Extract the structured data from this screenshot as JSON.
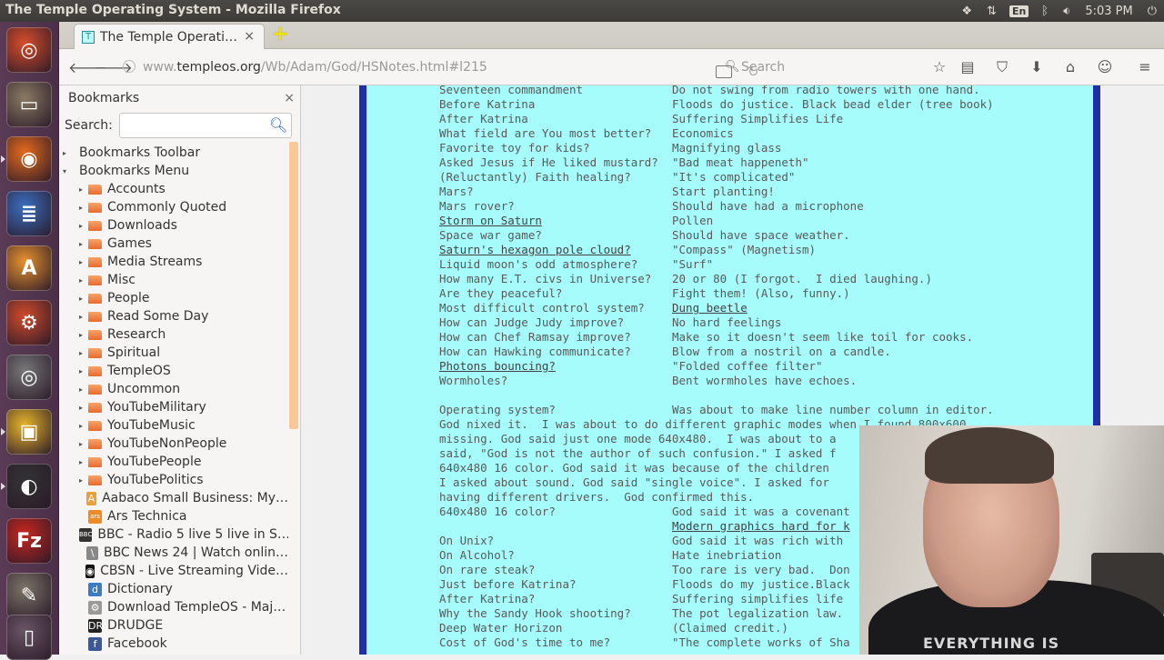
{
  "window": {
    "title": "The Temple Operating System - Mozilla Firefox"
  },
  "panel": {
    "keyboard": "En",
    "clock": "5:03 PM"
  },
  "launcher": {
    "items": [
      {
        "name": "ubuntu-dash-icon",
        "color": "#d84d2a",
        "glyph": "◎"
      },
      {
        "name": "files-icon",
        "color": "#8a7a62",
        "glyph": "▭"
      },
      {
        "name": "firefox-icon",
        "color": "#e66a1c",
        "glyph": "◉"
      },
      {
        "name": "writer-icon",
        "color": "#3a6ec0",
        "glyph": "≣"
      },
      {
        "name": "software-center-icon",
        "color": "#e8922e",
        "glyph": "A"
      },
      {
        "name": "system-settings-icon",
        "color": "#cf4a2b",
        "glyph": "⚙"
      },
      {
        "name": "dvd-icon",
        "color": "#777777",
        "glyph": "◎"
      },
      {
        "name": "workspace-switcher-icon",
        "color": "#e7b52a",
        "glyph": "▣"
      },
      {
        "name": "obs-icon",
        "color": "#333333",
        "glyph": "◐"
      },
      {
        "name": "filezilla-icon",
        "color": "#c8261e",
        "glyph": "Fz"
      },
      {
        "name": "gimp-icon",
        "color": "#7b7367",
        "glyph": "✎"
      },
      {
        "name": "trash-icon",
        "color": "#6a5565",
        "glyph": "▯"
      }
    ]
  },
  "tab": {
    "title": "The Temple Operati…",
    "favicon": "T"
  },
  "navbar": {
    "url_prefix": "www.",
    "url_domain": "templeos.org",
    "url_path": "/Wb/Adam/God/HSNotes.html#l215",
    "search_placeholder": "Search"
  },
  "sidebar": {
    "title": "Bookmarks",
    "search_label": "Search:",
    "items": [
      {
        "label": "Bookmarks Toolbar",
        "kind": "root-closed"
      },
      {
        "label": "Bookmarks Menu",
        "kind": "root-open"
      },
      {
        "label": "Accounts",
        "kind": "folder"
      },
      {
        "label": "Commonly Quoted",
        "kind": "folder"
      },
      {
        "label": "Downloads",
        "kind": "folder"
      },
      {
        "label": "Games",
        "kind": "folder"
      },
      {
        "label": "Media Streams",
        "kind": "folder"
      },
      {
        "label": "Misc",
        "kind": "folder"
      },
      {
        "label": "People",
        "kind": "folder"
      },
      {
        "label": "Read Some Day",
        "kind": "folder"
      },
      {
        "label": "Research",
        "kind": "folder"
      },
      {
        "label": "Spiritual",
        "kind": "folder"
      },
      {
        "label": "TempleOS",
        "kind": "folder"
      },
      {
        "label": "Uncommon",
        "kind": "folder"
      },
      {
        "label": "YouTubeMilitary",
        "kind": "folder"
      },
      {
        "label": "YouTubeMusic",
        "kind": "folder"
      },
      {
        "label": "YouTubeNonPeople",
        "kind": "folder"
      },
      {
        "label": "YouTubePeople",
        "kind": "folder"
      },
      {
        "label": "YouTubePolitics",
        "kind": "folder"
      },
      {
        "label": "Aabaco Small Business: My…",
        "kind": "link",
        "icon": "A",
        "color": "#e8a13a"
      },
      {
        "label": "Ars Technica",
        "kind": "link",
        "icon": "ars",
        "color": "#f08a24"
      },
      {
        "label": "BBC - Radio 5 live 5 live in S…",
        "kind": "link",
        "icon": "BBC",
        "color": "#333333"
      },
      {
        "label": "BBC News 24 | Watch onlin…",
        "kind": "link",
        "icon": "\\",
        "color": "#888888"
      },
      {
        "label": "CBSN - Live Streaming Vide…",
        "kind": "link",
        "icon": "◉",
        "color": "#111111"
      },
      {
        "label": "Dictionary",
        "kind": "link",
        "icon": "d",
        "color": "#3a7bc8"
      },
      {
        "label": "Download TempleOS - Maj…",
        "kind": "link",
        "icon": "⚙",
        "color": "#999999"
      },
      {
        "label": "DRUDGE",
        "kind": "link",
        "icon": "DR",
        "color": "#222222"
      },
      {
        "label": "Facebook",
        "kind": "link",
        "icon": "f",
        "color": "#3b5998"
      }
    ]
  },
  "doc": {
    "rows": [
      {
        "q": "Seventeen commandment",
        "a": "Do not swing from radio towers with one hand."
      },
      {
        "q": "Before Katrina",
        "a": "Floods do justice. Black bead elder (tree book)"
      },
      {
        "q": "After Katrina",
        "a": "Suffering Simplifies Life"
      },
      {
        "q": "What field are You most better?",
        "a": "Economics"
      },
      {
        "q": "Favorite toy for kids?",
        "a": "Magnifying glass"
      },
      {
        "q": "Asked Jesus if He liked mustard?",
        "a": "\"Bad meat happeneth\""
      },
      {
        "q": "(Reluctantly) Faith healing?",
        "a": "\"It's complicated\""
      },
      {
        "q": "Mars?",
        "a": "Start planting!"
      },
      {
        "q": "Mars rover?",
        "a": "Should have had a microphone"
      },
      {
        "q": "Storm on Saturn",
        "a": "Pollen",
        "qlink": true
      },
      {
        "q": "Space war game?",
        "a": "Should have space weather."
      },
      {
        "q": "Saturn's hexagon pole cloud?",
        "a": "\"Compass\" (Magnetism)",
        "qlink": true
      },
      {
        "q": "Liquid moon's odd atmosphere?",
        "a": "\"Surf\""
      },
      {
        "q": "How many E.T. civs in Universe?",
        "a": "20 or 80 (I forgot.  I died laughing.)"
      },
      {
        "q": "Are they peaceful?",
        "a": "Fight them! (Also, funny.)"
      },
      {
        "q": "Most difficult control system?",
        "a": "Dung beetle",
        "alink": true
      },
      {
        "q": "How can Judge Judy improve?",
        "a": "No hard feelings"
      },
      {
        "q": "How can Chef Ramsay improve?",
        "a": "Make so it doesn't seem like toil for cooks."
      },
      {
        "q": "How can Hawking communicate?",
        "a": "Blow from a nostril on a candle."
      },
      {
        "q": "Photons bouncing?",
        "a": "\"Folded coffee filter\"",
        "qlink": true
      },
      {
        "q": "Wormholes?",
        "a": "Bent wormholes have echoes."
      }
    ],
    "os_q": "Operating system?",
    "os_a": "Was about to make line number column in editor.",
    "paragraph": [
      "God nixed it.  I was about to do different graphic modes when I found 800x600",
      "missing. God said just one mode 640x480.  I was about to a",
      "said, \"God is not the author of such confusion.\" I asked f",
      "640x480 16 color. God said it was because of the children",
      "I asked about sound. God said \"single voice\". I asked for",
      "having different drivers.  God confirmed this."
    ],
    "rows2": [
      {
        "q": "640x480 16 color?",
        "a": "God said it was a covenant"
      },
      {
        "q": "",
        "a": "Modern graphics hard for k",
        "alink": true
      },
      {
        "q": "On Unix?",
        "a": "God said it was rich with"
      },
      {
        "q": "On Alcohol?",
        "a": "Hate inebriation"
      },
      {
        "q": "On rare steak?",
        "a": "Too rare is very bad.  Don"
      },
      {
        "q": "Just before Katrina?",
        "a": "Floods do my justice.Black"
      },
      {
        "q": "After Katrina?",
        "a": "Suffering simplifies life"
      },
      {
        "q": "Why the Sandy Hook shooting?",
        "a": "The pot legalization law."
      },
      {
        "q": "Deep Water Horizon",
        "a": "(Claimed credit.)"
      },
      {
        "q": "Cost of God's time to me?",
        "a": "\"The complete works of Sha"
      }
    ]
  },
  "webcam": {
    "shirt_text": "EVERYTHING IS"
  }
}
